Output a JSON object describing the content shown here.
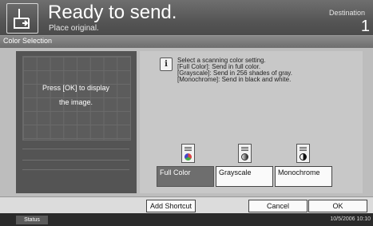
{
  "header": {
    "title": "Ready to send.",
    "subtitle": "Place original.",
    "destination_label": "Destination",
    "destination_count": "1"
  },
  "section": {
    "title": "Color Selection"
  },
  "preview": {
    "line1": "Press [OK] to display",
    "line2": "the image."
  },
  "info": {
    "lines": [
      "Select a scanning color setting.",
      "[Full Color]: Send in full color.",
      "[Grayscale]: Send in 256 shades of gray.",
      "[Monochrome]: Send in black and white."
    ]
  },
  "options": [
    {
      "label": "Full Color",
      "icon": "color-scan-icon",
      "selected": true
    },
    {
      "label": "Grayscale",
      "icon": "grayscale-scan-icon",
      "selected": false
    },
    {
      "label": "Monochrome",
      "icon": "monochrome-scan-icon",
      "selected": false
    }
  ],
  "footer": {
    "add_shortcut": "Add Shortcut",
    "cancel": "Cancel",
    "ok": "OK"
  },
  "status": {
    "button": "Status",
    "datetime": "10/5/2006   10:10"
  }
}
